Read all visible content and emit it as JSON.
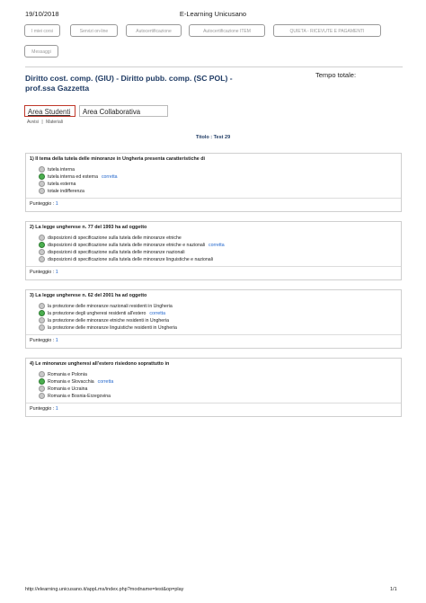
{
  "header": {
    "date": "19/10/2018",
    "title": "E-Learning Unicusano"
  },
  "nav": {
    "buttons": [
      "I miei corsi",
      "Servizi on-line",
      "Autocertificazione",
      "Autocertificazione ITEM",
      "QUIETA - RICEVUTE E PAGAMENTI",
      "Messaggi"
    ]
  },
  "course": {
    "title_line1": "Diritto cost. comp. (GIU) - Diritto pubb. comp. (SC POL) -",
    "title_line2": "prof.ssa Gazzetta",
    "tempo_label": "Tempo totale:"
  },
  "tabs": {
    "active": "Area Studenti",
    "other": "Area Collaborativa"
  },
  "subnav": {
    "avvisi": "Avvisi",
    "sep": "|",
    "materiali": "Materiali"
  },
  "test_title": "Titolo : Test 29",
  "correct_label": "corretta",
  "punteggio_label": "Punteggio :",
  "questions": [
    {
      "text": "1) Il tema della tutela delle minoranze in Ungheria presenta caratteristiche di",
      "options": [
        "tutela interna",
        "tutela interna ed esterna",
        "tutela esterna",
        "totale indifferenza"
      ],
      "selected": 1,
      "score": "1"
    },
    {
      "text": "2) La legge ungherese n. 77 del 1993 ha ad oggetto",
      "options": [
        "disposizioni di specificazione sulla tutela delle minoranze etniche",
        "disposizioni di specificazione sulla tutela delle minoranze etniche e nazionali",
        "disposizioni di specificazione sulla tutela delle minoranze nazionali",
        "disposizioni di specificazione sulla tutela delle minoranze linguistiche e nazionali"
      ],
      "selected": 1,
      "score": "1"
    },
    {
      "text": "3) La legge ungherese n. 62 del 2001 ha ad oggetto",
      "options": [
        "la protezione delle minoranze nazionali residenti in Ungheria",
        "la protezione degli ungheresi residenti all'estero",
        "la protezione delle minoranze etniche residenti in Ungheria",
        "la protezione delle minoranze linguistiche residenti in Ungheria"
      ],
      "selected": 1,
      "score": "1"
    },
    {
      "text": "4) Le minoranze ungheresi all'estero risiedono soprattutto in",
      "options": [
        "Romania e Polonia",
        "Romania e Slovacchia",
        "Romania e Ucraina",
        "Romania e Bosnia-Erzegovina"
      ],
      "selected": 1,
      "score": "1"
    }
  ],
  "footer": {
    "url": "http://elearning.unicusano.it/appLms/index.php?modname=test&op=play",
    "page": "1/1"
  }
}
